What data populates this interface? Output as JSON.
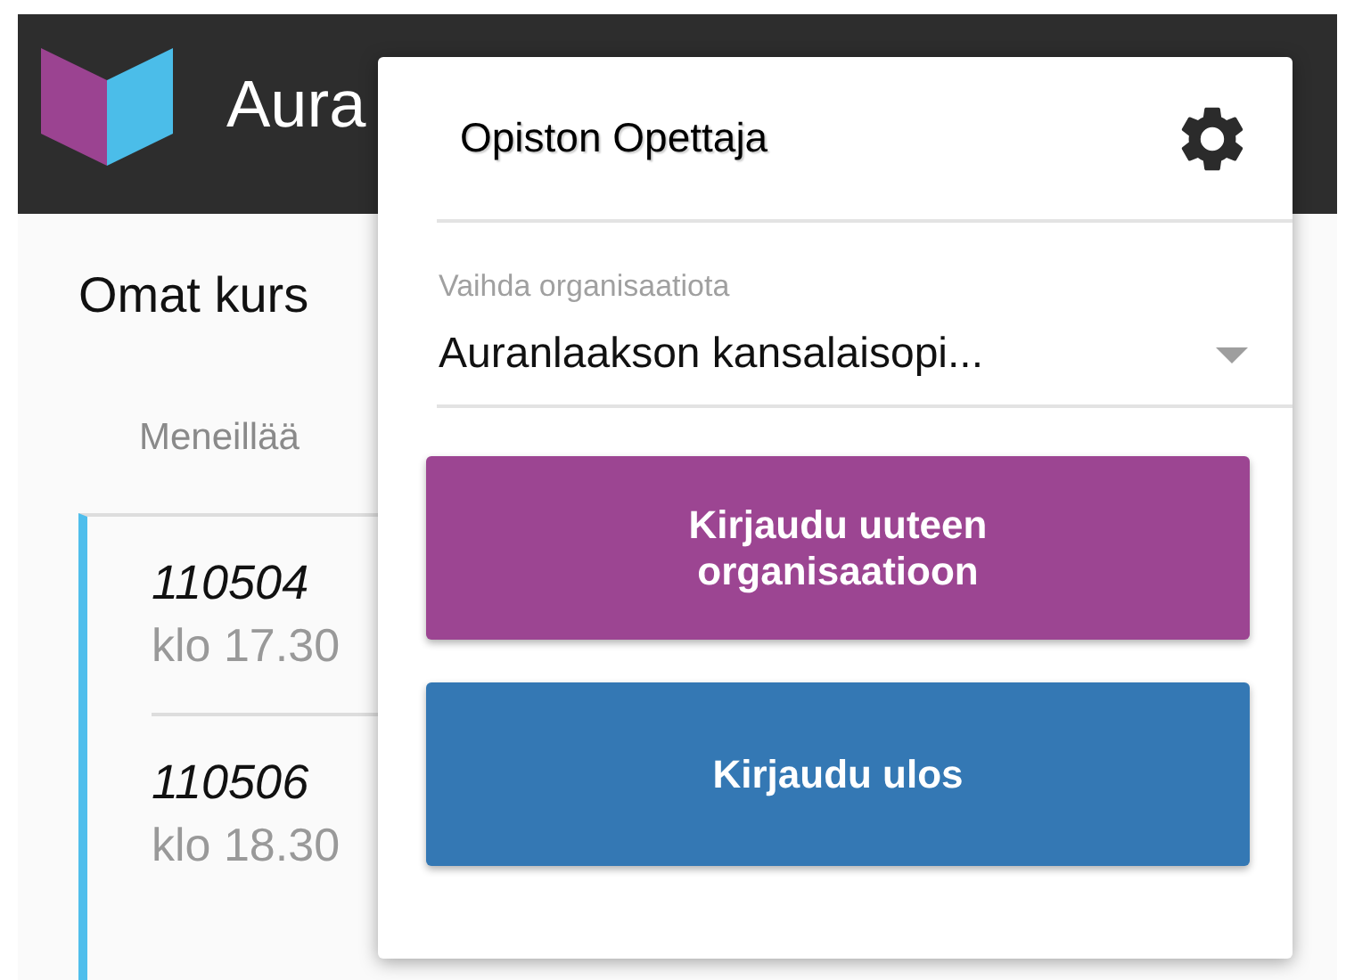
{
  "header": {
    "title": "Aura"
  },
  "page": {
    "heading": "Omat kurs",
    "tab": "Meneillää",
    "courses": [
      {
        "code": "110504",
        "time": "klo 17.30"
      },
      {
        "code": "110506",
        "time": "klo 18.30"
      }
    ]
  },
  "menu": {
    "user": "Opiston Opettaja",
    "org_label": "Vaihda organisaatiota",
    "org_value": "Auranlaakson kansalaisopi...",
    "buttons": [
      {
        "label": "Kirjaudu uuteen organisaatioon",
        "kind": "primary"
      },
      {
        "label": "Kirjaudu ulos",
        "kind": "secondary"
      }
    ]
  }
}
